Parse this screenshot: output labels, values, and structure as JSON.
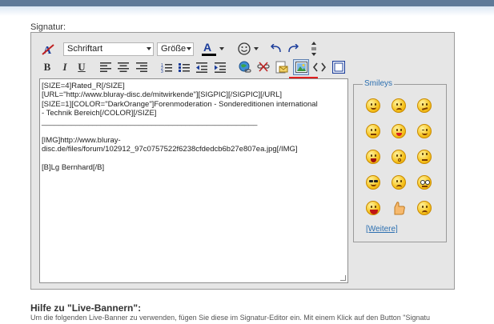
{
  "signature_label": "Signatur:",
  "toolbar": {
    "font_select": "Schriftart",
    "size_select": "Größe",
    "font_color_letter": "A",
    "bold": "B",
    "italic": "I",
    "underline": "U"
  },
  "editor_text": [
    "[SIZE=4]Rated_R[/SIZE]",
    "[URL=\"http://www.bluray-disc.de/mitwirkende\"][SIGPIC][/SIGPIC][/URL]",
    "[SIZE=1][COLOR=\"DarkOrange\"]Forenmoderation - Sondereditionen international",
    "- Technik Bereich[/COLOR][/SIZE]",
    "___________________________________________________",
    "",
    "[IMG]http://www.bluray-",
    "disc.de/files/forum/102912_97c0757522f6238cfdedcb6b27e807ea.jpg[/IMG]",
    "",
    "[B]Lg Bernhard[/B]"
  ],
  "smileys": {
    "legend": "Smileys",
    "more_link": "[Weitere]"
  },
  "help": {
    "title": "Hilfe zu \"Live-Bannern\":",
    "text": "Um die folgenden Live-Banner zu verwenden, fügen Sie diese im Signatur-Editor ein. Mit einem Klick auf den Button \"Signatu"
  }
}
